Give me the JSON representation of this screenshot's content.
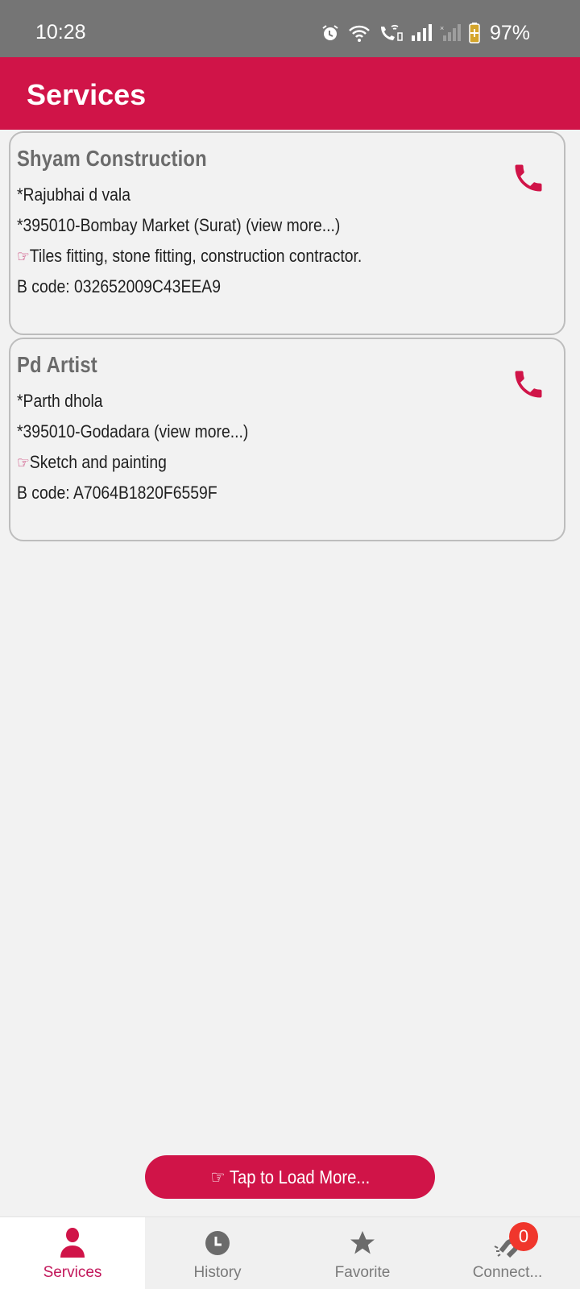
{
  "status_bar": {
    "time": "10:28",
    "battery": "97%",
    "icons": [
      "alarm-icon",
      "wifi-icon",
      "wifi-call-icon",
      "signal-icon",
      "signal-off-icon",
      "battery-charging-icon"
    ]
  },
  "app_bar": {
    "title": "Services"
  },
  "services": [
    {
      "name": "Shyam Construction",
      "contact": "*Rajubhai d vala",
      "address": "*395010-Bombay Market (Surat) (view more...)",
      "hand": "☞",
      "description": "Tiles fitting, stone fitting, construction contractor.",
      "bcode": "B code: 032652009C43EEA9"
    },
    {
      "name": "Pd Artist",
      "contact": "*Parth dhola",
      "address": "*395010-Godadara (view more...)",
      "hand": "☞",
      "description": "Sketch and painting",
      "bcode": "B code: A7064B1820F6559F"
    }
  ],
  "load_more": {
    "label": "☞ Tap to Load More..."
  },
  "bottom_nav": {
    "items": [
      {
        "label": "Services",
        "icon": "person-icon",
        "active": true
      },
      {
        "label": "History",
        "icon": "clock-icon",
        "active": false
      },
      {
        "label": "Favorite",
        "icon": "star-icon",
        "active": false
      },
      {
        "label": "Connect...",
        "icon": "magnet-icon",
        "active": false,
        "badge": "0"
      }
    ]
  },
  "colors": {
    "primary": "#d01448",
    "status_bar": "#757575",
    "background": "#f2f2f2",
    "badge": "#f0362c",
    "inactive": "#7a7a7a"
  }
}
